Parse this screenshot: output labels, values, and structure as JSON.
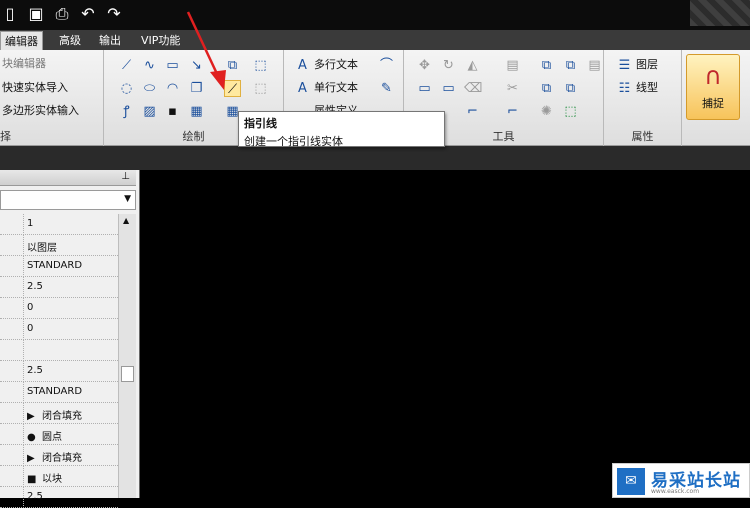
{
  "quick_access": {
    "icons": [
      "open-icon",
      "save-icon",
      "print-icon",
      "undo-icon",
      "redo-icon"
    ]
  },
  "menu": {
    "tabs": [
      "编辑器",
      "高级",
      "输出",
      "VIP功能"
    ],
    "active": "编辑器"
  },
  "ribbon": {
    "left_items": [
      "块编辑器",
      "快速实体导入",
      "多边形实体输入"
    ],
    "left_group_label": "择",
    "draw_group_label": "绘制",
    "text_items": [
      "多行文本",
      "单行文本",
      "属性定义"
    ],
    "tools_group_label": "工具",
    "props_items": [
      "图层",
      "线型"
    ],
    "props_group_label": "属性",
    "capture_label": "捕捉"
  },
  "tooltip": {
    "title": "指引线",
    "desc": "创建一个指引线实体"
  },
  "properties": {
    "rows": [
      {
        "mark": "",
        "value": "1"
      },
      {
        "mark": "",
        "value": "以图层"
      },
      {
        "mark": "",
        "value": "STANDARD"
      },
      {
        "mark": "",
        "value": "2.5"
      },
      {
        "mark": "",
        "value": "0"
      },
      {
        "mark": "",
        "value": "0"
      },
      {
        "mark": "",
        "value": ""
      },
      {
        "mark": "",
        "value": "2.5"
      },
      {
        "mark": "",
        "value": "STANDARD"
      },
      {
        "mark": "▶",
        "value": "闭合填充"
      },
      {
        "mark": "●",
        "value": "圆点"
      },
      {
        "mark": "▶",
        "value": "闭合填充"
      },
      {
        "mark": "■",
        "value": "以块"
      },
      {
        "mark": "",
        "value": "2.5"
      }
    ]
  },
  "watermark": {
    "name": "易采站长站",
    "url": "www.easck.com"
  },
  "colors": {
    "background": "#000000",
    "ribbon": "#e8e8e8",
    "menubar": "#3a3a3a",
    "arrow": "#e02020"
  }
}
